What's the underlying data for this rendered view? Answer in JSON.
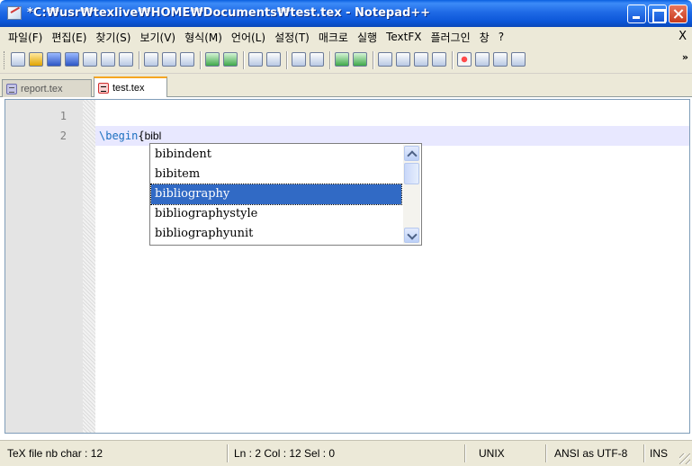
{
  "window": {
    "title": "*C:₩usr₩texlive₩HOME₩Documents₩test.tex - Notepad++"
  },
  "menu": {
    "items": [
      "파일(F)",
      "편집(E)",
      "찾기(S)",
      "보기(V)",
      "형식(M)",
      "언어(L)",
      "설정(T)",
      "매크로",
      "실행",
      "TextFX",
      "플러그인",
      "창",
      "?"
    ],
    "close_label": "X"
  },
  "toolbar": {
    "more_label": "»"
  },
  "tabs": [
    {
      "label": "report.tex",
      "active": false
    },
    {
      "label": "test.tex",
      "active": true
    }
  ],
  "editor": {
    "line_numbers": [
      "1",
      "2"
    ],
    "line2": {
      "keyword": "\\begin",
      "brace": "{",
      "typed": "bibl"
    }
  },
  "autocomplete": {
    "items": [
      "bibindent",
      "bibitem",
      "bibliography",
      "bibliographystyle",
      "bibliographyunit"
    ],
    "selected_index": 2
  },
  "statusbar": {
    "file_info": "TeX file nb char : 12",
    "position": "Ln : 2    Col : 12    Sel : 0",
    "eol": "UNIX",
    "encoding": "ANSI as UTF-8",
    "mode": "INS"
  },
  "colors": {
    "title_blue": "#0b56d8",
    "keyword": "#1a6fbf",
    "current_line": "#e8e8ff",
    "selection": "#316ac5",
    "active_tab_accent": "#f5a623"
  }
}
